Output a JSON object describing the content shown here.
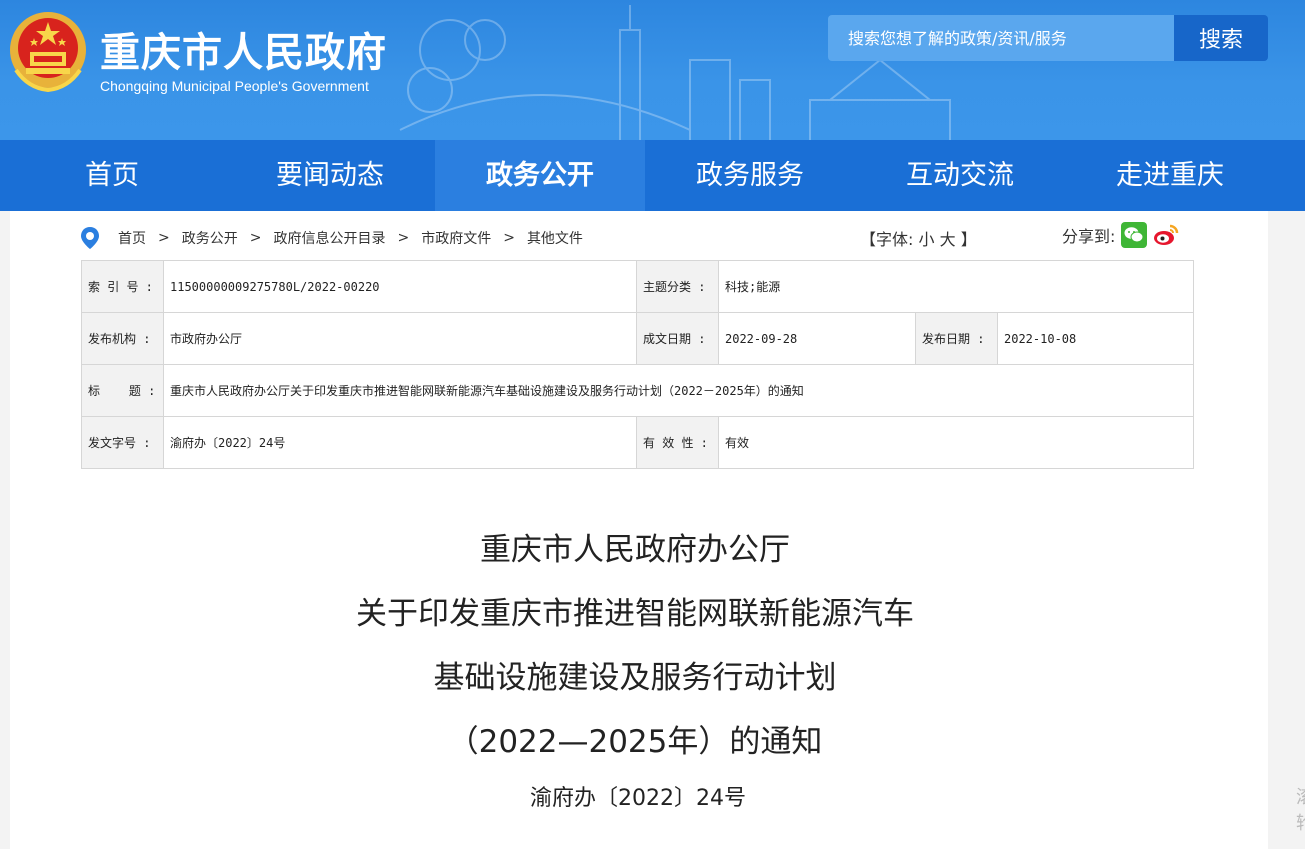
{
  "header": {
    "site_title": "重庆市人民政府",
    "site_subtitle": "Chongqing Municipal People's Government",
    "search_placeholder": "搜索您想了解的政策/资讯/服务",
    "search_button": "搜索"
  },
  "nav": [
    {
      "label": "首页",
      "active": false
    },
    {
      "label": "要闻动态",
      "active": false
    },
    {
      "label": "政务公开",
      "active": true
    },
    {
      "label": "政务服务",
      "active": false
    },
    {
      "label": "互动交流",
      "active": false
    },
    {
      "label": "走进重庆",
      "active": false
    }
  ],
  "breadcrumb": [
    "首页",
    "政务公开",
    "政府信息公开目录",
    "市政府文件",
    "其他文件"
  ],
  "breadcrumb_sep": ">",
  "font_size": {
    "open": "【字体:",
    "small": "小",
    "large": "大",
    "close": "】"
  },
  "share_label": "分享到:",
  "meta": {
    "index_no_label": "索 引 号 :",
    "index_no": "11500000009275780L/2022-00220",
    "topic_label": "主题分类 :",
    "topic": "科技;能源",
    "publisher_label": "发布机构 :",
    "publisher": "市政府办公厅",
    "created_label": "成文日期 :",
    "created": "2022-09-28",
    "published_label": "发布日期 :",
    "published": "2022-10-08",
    "title_label": "标    题 :",
    "title": "重庆市人民政府办公厅关于印发重庆市推进智能网联新能源汽车基础设施建设及服务行动计划（2022－2025年）的通知",
    "doc_no_label": "发文字号 :",
    "doc_no": "渝府办〔2022〕24号",
    "validity_label": "有 效 性 :",
    "validity": "有效"
  },
  "doc": {
    "title_lines": [
      "重庆市人民政府办公厅",
      "关于印发重庆市推进智能网联新能源汽车",
      "基础设施建设及服务行动计划",
      "（2022—2025年）的通知"
    ],
    "number": "渝府办〔2022〕24号"
  },
  "edge_text": [
    "滚",
    "轮"
  ],
  "colors": {
    "header_blue": "#3a94e8",
    "nav_blue": "#1a6fd6",
    "nav_active": "#2b7fe0",
    "search_btn": "#1766c9"
  }
}
